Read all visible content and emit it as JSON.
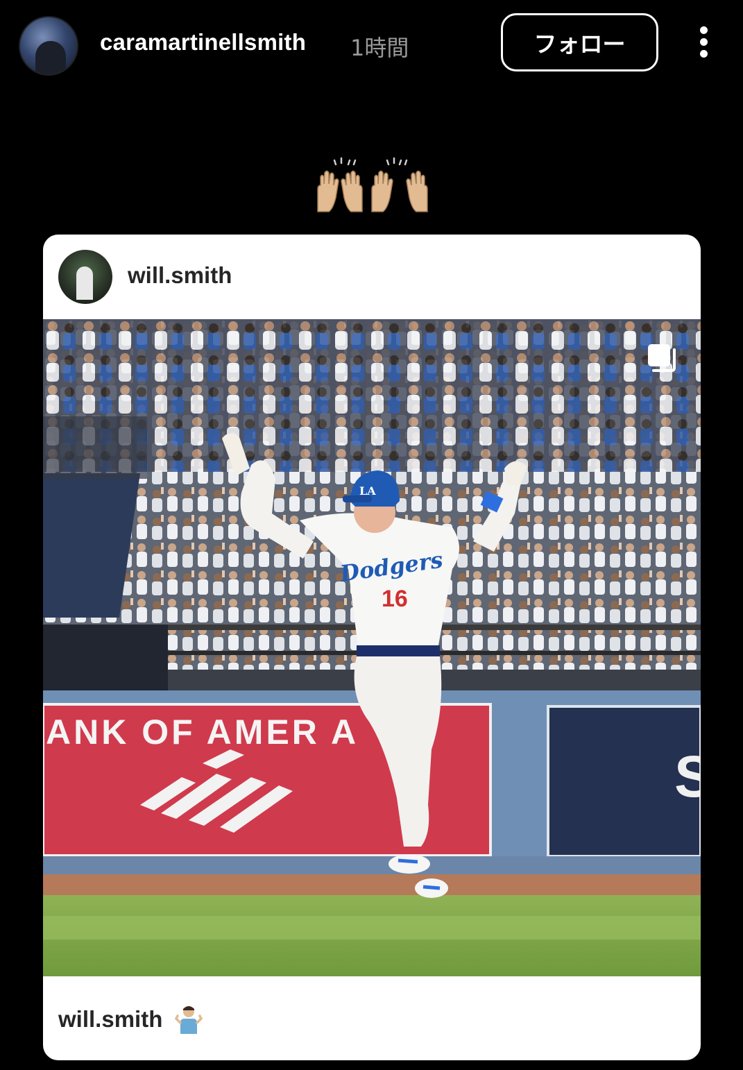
{
  "post": {
    "username": "caramartinellsmith",
    "time": "1時間",
    "follow_label": "フォロー",
    "more_icon": "more-vertical-icon",
    "caption_emoji": "raised-hands-emoji"
  },
  "shared_post": {
    "username": "will.smith",
    "footer_username": "will.smith",
    "footer_emoji": "person-shrugging-emoji",
    "carousel_icon": "multi-photo-icon",
    "photo": {
      "jersey_script": "Dodgers",
      "jersey_number": "16",
      "helmet_logo": "LA",
      "banner_text": "ANK OF AMER A",
      "right_banner_letter": "S"
    }
  },
  "colors": {
    "background": "#000000",
    "card": "#ffffff",
    "dodger_blue": "#1f5bb5",
    "jersey_red": "#d22f2f",
    "bank_red": "#d03a4d"
  }
}
